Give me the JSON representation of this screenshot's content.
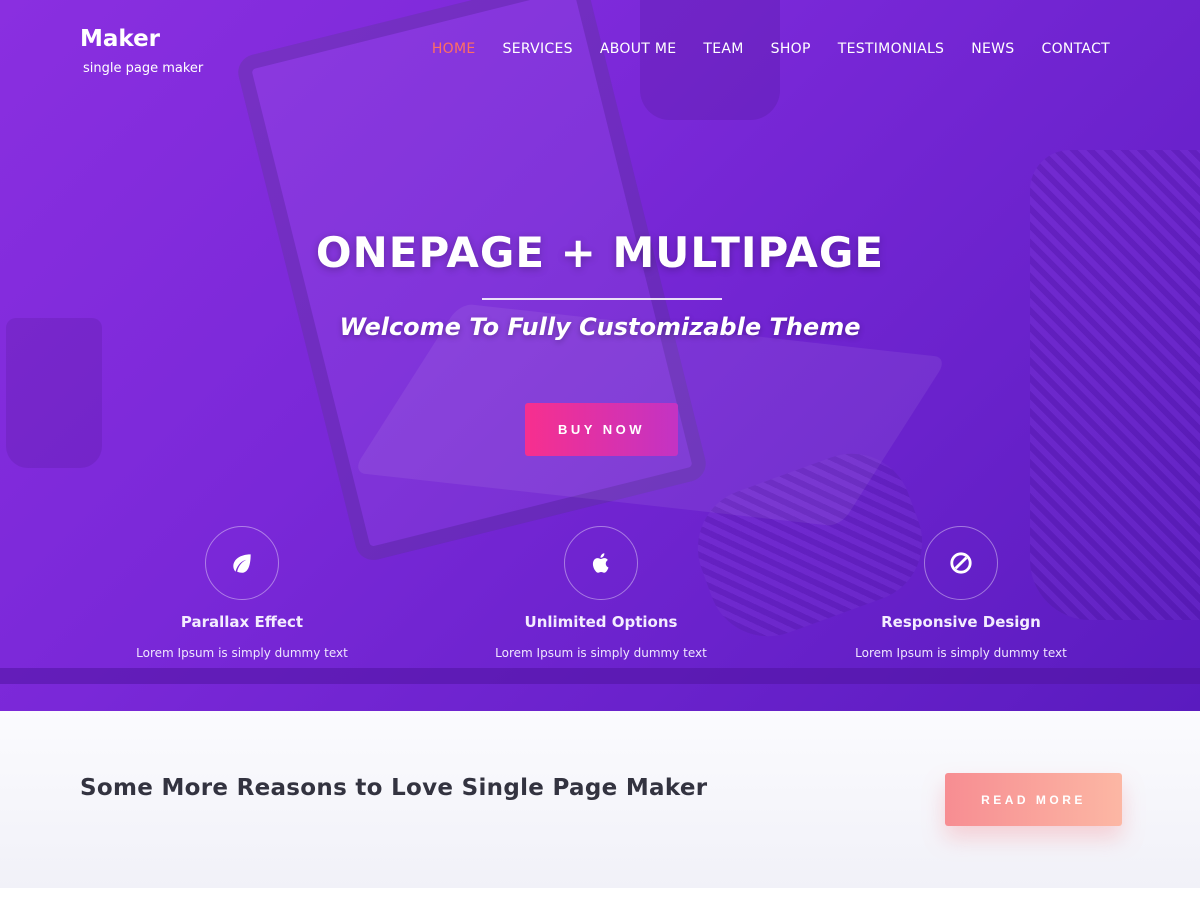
{
  "site": {
    "title": "Maker",
    "tagline": "single page maker"
  },
  "nav": {
    "items": [
      {
        "label": "HOME",
        "active": true
      },
      {
        "label": "SERVICES",
        "active": false
      },
      {
        "label": "ABOUT ME",
        "active": false
      },
      {
        "label": "TEAM",
        "active": false
      },
      {
        "label": "SHOP",
        "active": false
      },
      {
        "label": "TESTIMONIALS",
        "active": false
      },
      {
        "label": "NEWS",
        "active": false
      },
      {
        "label": "CONTACT",
        "active": false
      }
    ],
    "active_color": "#ff6f61"
  },
  "hero": {
    "title": "ONEPAGE + MULTIPAGE",
    "subtitle": "Welcome To Fully Customizable Theme",
    "cta_label": "BUY NOW",
    "overlay_color": "#7a28d8",
    "cta_gradient": [
      "#f72f8e",
      "#c333c4"
    ]
  },
  "features": [
    {
      "icon": "leaf-icon",
      "title": "Parallax Effect",
      "text": "Lorem Ipsum is simply dummy text"
    },
    {
      "icon": "apple-icon",
      "title": "Unlimited Options",
      "text": "Lorem Ipsum is simply dummy text"
    },
    {
      "icon": "ban-icon",
      "title": "Responsive Design",
      "text": "Lorem Ipsum is simply dummy text"
    }
  ],
  "reasons": {
    "title": "Some More Reasons to Love Single Page Maker",
    "cta_label": "READ MORE",
    "cta_gradient": [
      "#f78d92",
      "#fcb7a4"
    ]
  }
}
